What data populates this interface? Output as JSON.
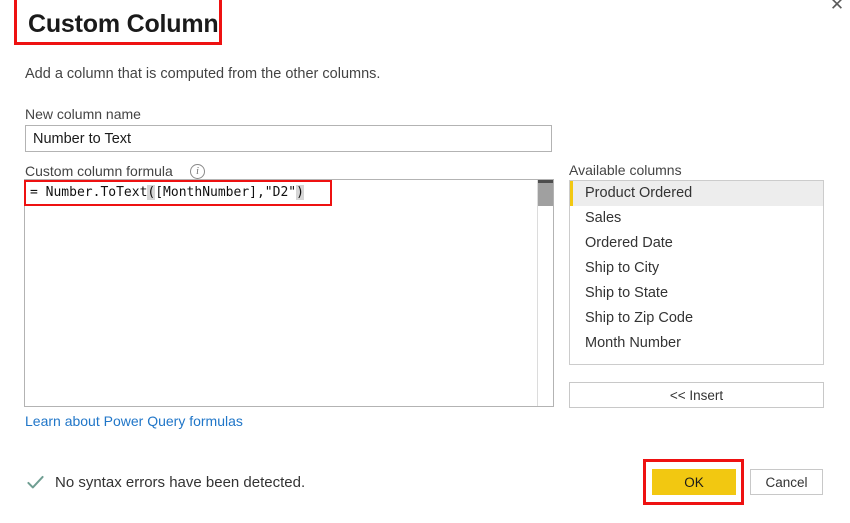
{
  "dialog": {
    "title": "Custom Column",
    "description": "Add a column that is computed from the other columns.",
    "close_label": "✕"
  },
  "new_column": {
    "label": "New column name",
    "value": "Number to Text",
    "placeholder": ""
  },
  "formula": {
    "label": "Custom column formula",
    "info_glyph": "i",
    "text_prefix": "= Number.ToText",
    "open_paren": "(",
    "text_middle": "[MonthNumber],\"D2\"",
    "close_paren": ")",
    "full_text": "= Number.ToText([MonthNumber],\"D2\")"
  },
  "learn_link": "Learn about Power Query formulas",
  "status": {
    "text": "No syntax errors have been detected.",
    "icon": "checkmark-icon",
    "icon_color": "#6f9e92"
  },
  "available_columns": {
    "label": "Available columns",
    "items": [
      {
        "label": "Product Ordered",
        "selected": true
      },
      {
        "label": "Sales",
        "selected": false
      },
      {
        "label": "Ordered Date",
        "selected": false
      },
      {
        "label": "Ship to City",
        "selected": false
      },
      {
        "label": "Ship to State",
        "selected": false
      },
      {
        "label": "Ship to Zip Code",
        "selected": false
      },
      {
        "label": "Month Number",
        "selected": false
      }
    ],
    "insert_label": "<< Insert"
  },
  "footer": {
    "ok_label": "OK",
    "cancel_label": "Cancel"
  },
  "colors": {
    "accent": "#f2c811",
    "link": "#2076c8",
    "annotation": "#ee1111",
    "selected_row_bg": "#ededed"
  }
}
